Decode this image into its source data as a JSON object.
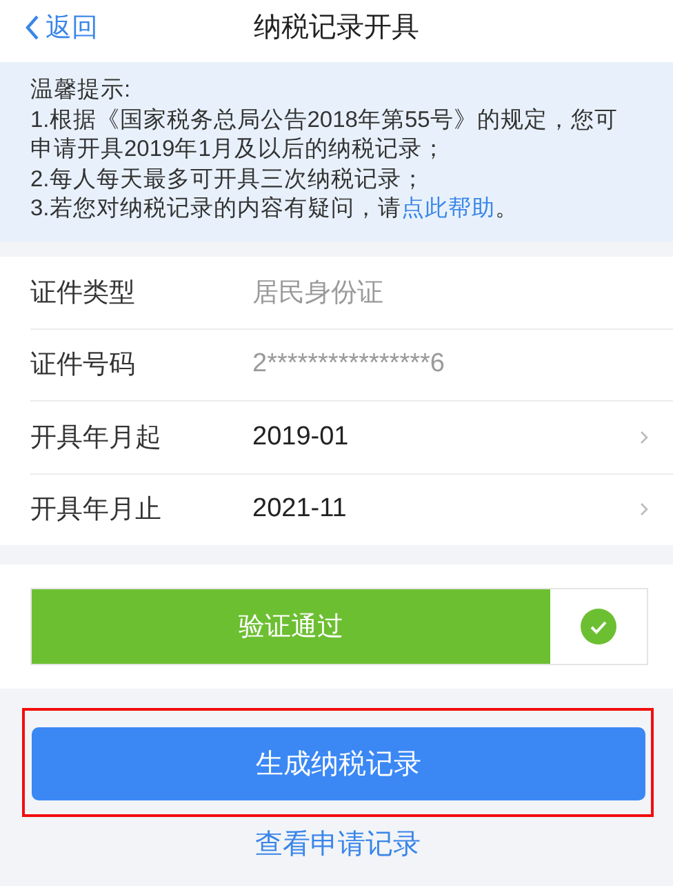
{
  "header": {
    "back": "返回",
    "title": "纳税记录开具"
  },
  "notice": {
    "title": "温馨提示:",
    "items": [
      {
        "text": "1.根据《国家税务总局公告2018年第55号》的规定，您可申请开具2019年1月及以后的纳税记录；"
      },
      {
        "text": "2.每人每天最多可开具三次纳税记录；"
      },
      {
        "text": "3.若您对纳税记录的内容有疑问，请",
        "link": "点此帮助",
        "after": "。"
      }
    ]
  },
  "form": [
    {
      "kind": "readonly",
      "label": "证件类型",
      "value": "居民身份证"
    },
    {
      "kind": "readonly",
      "label": "证件号码",
      "value": "2****************6"
    },
    {
      "kind": "picker",
      "label": "开具年月起",
      "value": "2019-01"
    },
    {
      "kind": "picker",
      "label": "开具年月止",
      "value": "2021-11"
    }
  ],
  "verification": {
    "label": "验证通过",
    "passed": true
  },
  "generate_button": {
    "label": "生成纳税记录",
    "highlighted": true
  },
  "history_link": "查看申请记录"
}
